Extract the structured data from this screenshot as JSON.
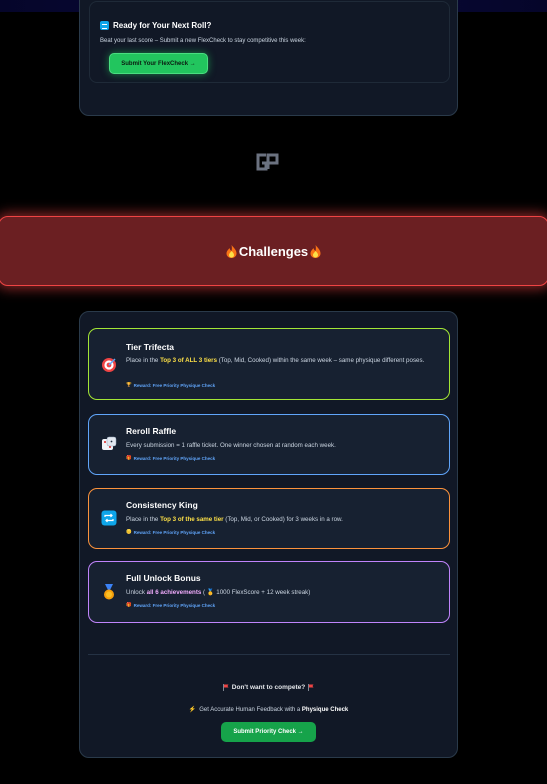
{
  "top_card": {
    "title": "Ready for Your Next Roll?",
    "subtitle": "Beat your last score – Submit a new FlexCheck to stay competitive this week:",
    "button_label": "Submit Your FlexCheck →"
  },
  "logo": {
    "text": "GP"
  },
  "banner": {
    "title": "Challenges"
  },
  "challenges": [
    {
      "title": "Tier Trifecta",
      "desc_pre": "Place in the ",
      "desc_hl": "Top 3 of ALL 3 tiers",
      "desc_post": " (Top, Mid, Cooked) within the same week – same physique different poses.",
      "reward": "Reward: Free Priority Physique Check",
      "icon": "target-icon",
      "border": "#a3e635"
    },
    {
      "title": "Reroll Raffle",
      "desc_pre": "Every submission = 1 raffle ticket. One winner chosen at random each week.",
      "desc_hl": "",
      "desc_post": "",
      "reward": "Reward: Free Priority Physique Check",
      "icon": "dice-icon",
      "border": "#60a5fa"
    },
    {
      "title": "Consistency King",
      "desc_pre": "Place in the ",
      "desc_hl": "Top 3 of the same tier",
      "desc_post": " (Top, Mid, or Cooked) for 3 weeks in a row.",
      "reward": "Reward: Free Priority Physique Check",
      "icon": "repeat-icon",
      "border": "#fb923c"
    },
    {
      "title": "Full Unlock Bonus",
      "desc_pre": "Unlock ",
      "desc_hl": "all 6 achievements",
      "desc_post": " ( 🥇 1000 FlexScore + 12 week streak)",
      "reward": "Reward: Free Priority Physique Check",
      "icon": "medal-icon",
      "border": "#c084fc"
    }
  ],
  "footer": {
    "question": "Don't want to compete?",
    "feedback_pre": "Get Accurate Human Feedback with a ",
    "feedback_hl": "Physique Check",
    "button_label": "Submit Priority Check →"
  },
  "colors": {
    "green": "#22c55e",
    "red_banner": "#6b1f22",
    "panel": "#111826"
  }
}
